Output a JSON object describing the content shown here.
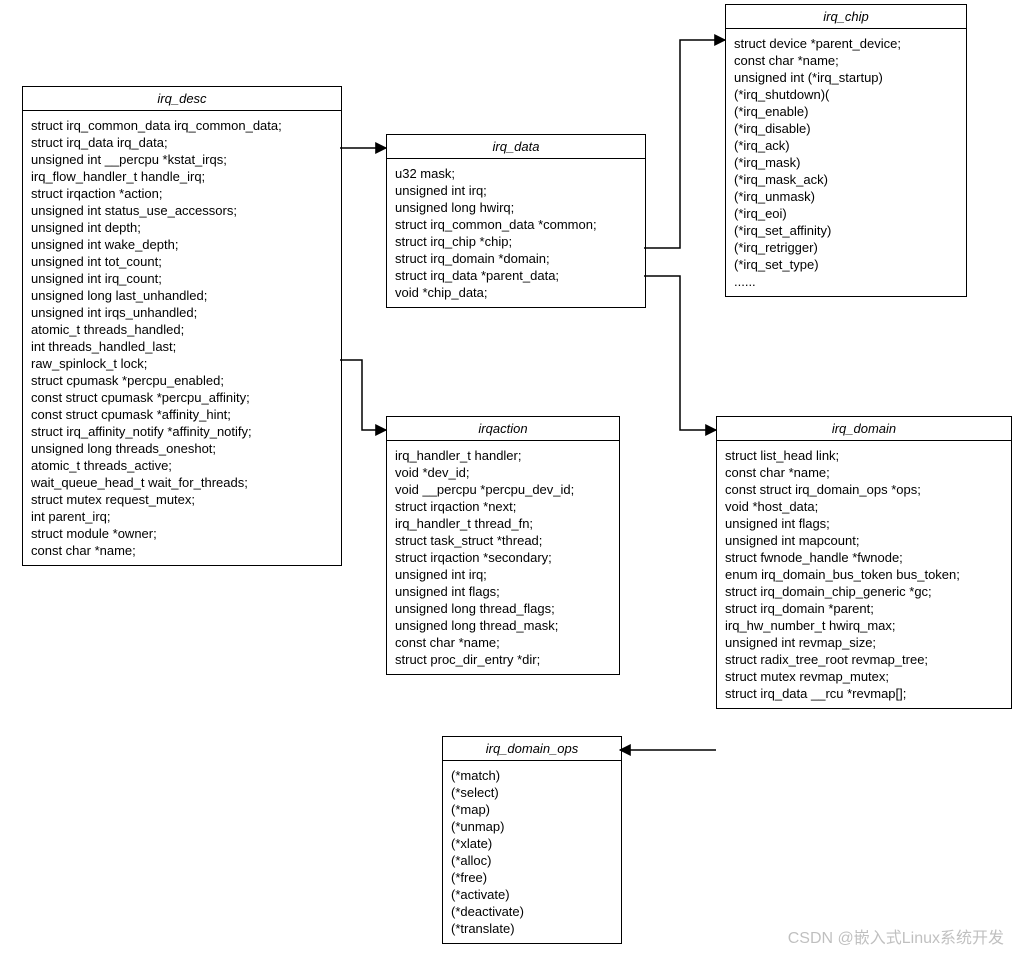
{
  "watermark": "CSDN @嵌入式Linux系统开发",
  "boxes": {
    "irq_desc": {
      "title": "irq_desc",
      "fields": [
        "struct irq_common_data irq_common_data;",
        "struct irq_data irq_data;",
        "unsigned int __percpu *kstat_irqs;",
        "irq_flow_handler_t handle_irq;",
        "struct irqaction *action;",
        "unsigned int status_use_accessors;",
        "unsigned int depth;",
        "unsigned int wake_depth;",
        "unsigned int tot_count;",
        "unsigned int irq_count;",
        "unsigned long last_unhandled;",
        "unsigned int irqs_unhandled;",
        "atomic_t threads_handled;",
        "int threads_handled_last;",
        "raw_spinlock_t lock;",
        "struct cpumask *percpu_enabled;",
        "const struct cpumask *percpu_affinity;",
        "const struct cpumask *affinity_hint;",
        "struct irq_affinity_notify *affinity_notify;",
        "unsigned long threads_oneshot;",
        "atomic_t threads_active;",
        "wait_queue_head_t      wait_for_threads;",
        "struct mutex request_mutex;",
        "int parent_irq;",
        "struct module *owner;",
        "const char *name;"
      ]
    },
    "irq_data": {
      "title": "irq_data",
      "fields": [
        "u32 mask;",
        "unsigned int irq;",
        "unsigned long hwirq;",
        "struct irq_common_data *common;",
        "struct irq_chip *chip;",
        "struct irq_domain *domain;",
        "struct irq_data *parent_data;",
        "void *chip_data;"
      ]
    },
    "irq_chip": {
      "title": "irq_chip",
      "fields": [
        "struct device *parent_device;",
        "const char *name;",
        "unsigned int (*irq_startup)",
        "(*irq_shutdown)(",
        "(*irq_enable)",
        "(*irq_disable)",
        "(*irq_ack)",
        "(*irq_mask)",
        "(*irq_mask_ack)",
        "(*irq_unmask)",
        "(*irq_eoi)",
        "(*irq_set_affinity)",
        "(*irq_retrigger)",
        "(*irq_set_type)",
        "......"
      ]
    },
    "irqaction": {
      "title": "irqaction",
      "fields": [
        "irq_handler_t handler;",
        "void *dev_id;",
        "void __percpu *percpu_dev_id;",
        "struct irqaction *next;",
        "irq_handler_t thread_fn;",
        "struct task_struct *thread;",
        "struct irqaction *secondary;",
        "unsigned int irq;",
        "unsigned int flags;",
        "unsigned long thread_flags;",
        "unsigned long thread_mask;",
        "const char *name;",
        "struct proc_dir_entry *dir;"
      ]
    },
    "irq_domain": {
      "title": "irq_domain",
      "fields": [
        "struct list_head link;",
        "const char *name;",
        "const struct irq_domain_ops *ops;",
        "void *host_data;",
        "unsigned int flags;",
        "unsigned int mapcount;",
        "struct fwnode_handle *fwnode;",
        "enum irq_domain_bus_token bus_token;",
        "struct irq_domain_chip_generic *gc;",
        "struct irq_domain *parent;",
        "irq_hw_number_t hwirq_max;",
        "unsigned int revmap_size;",
        "struct radix_tree_root revmap_tree;",
        "struct mutex revmap_mutex;",
        "struct irq_data __rcu *revmap[];"
      ]
    },
    "irq_domain_ops": {
      "title": "irq_domain_ops",
      "fields": [
        "(*match)",
        "(*select)",
        "(*map)",
        "(*unmap)",
        "(*xlate)",
        "(*alloc)",
        "(*free)",
        "(*activate)",
        "(*deactivate)",
        "(*translate)"
      ]
    }
  }
}
